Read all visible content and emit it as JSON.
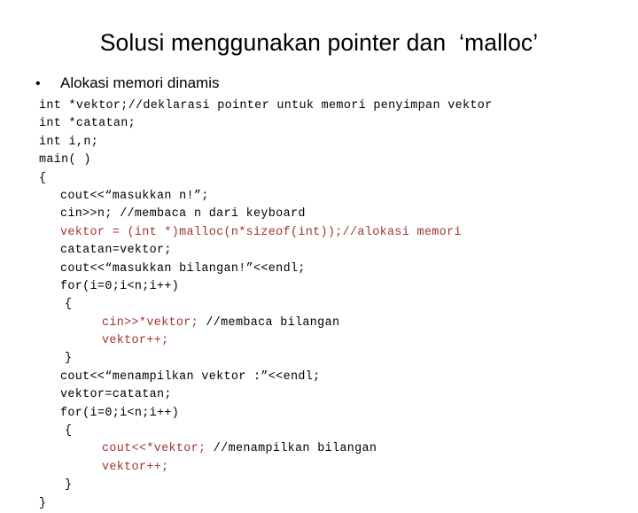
{
  "slide": {
    "title": "Solusi menggunakan pointer dan  ‘malloc’",
    "bullet_marker": "•",
    "bullet_text": "Alokasi memori dinamis",
    "colors": {
      "background": "#ffffff",
      "text": "#000000",
      "highlight": "#a33333"
    }
  },
  "code": {
    "lines": [
      {
        "indent": 0,
        "color": "#000000",
        "segments": [
          {
            "text": "int *vektor;//deklarasi pointer untuk memori penyimpan vektor",
            "color": "#000000"
          }
        ]
      },
      {
        "indent": 0,
        "color": "#000000",
        "segments": [
          {
            "text": "int *catatan;",
            "color": "#000000"
          }
        ]
      },
      {
        "indent": 0,
        "color": "#000000",
        "segments": [
          {
            "text": "int i,n;",
            "color": "#000000"
          }
        ]
      },
      {
        "indent": 0,
        "color": "#000000",
        "segments": [
          {
            "text": "main( )",
            "color": "#000000"
          }
        ]
      },
      {
        "indent": 0,
        "color": "#000000",
        "segments": [
          {
            "text": "{",
            "color": "#000000"
          }
        ]
      },
      {
        "indent": 1,
        "color": "#000000",
        "segments": [
          {
            "text": "cout<<“masukkan n!”;",
            "color": "#000000"
          }
        ]
      },
      {
        "indent": 1,
        "color": "#000000",
        "segments": [
          {
            "text": "cin>>n; //membaca n dari keyboard",
            "color": "#000000"
          }
        ]
      },
      {
        "indent": 1,
        "color": "#a33333",
        "segments": [
          {
            "text": "vektor = (int *)malloc(n*sizeof(int));//alokasi memori",
            "color": "#a33333"
          }
        ]
      },
      {
        "indent": 1,
        "color": "#000000",
        "segments": [
          {
            "text": "catatan=vektor;",
            "color": "#000000"
          }
        ]
      },
      {
        "indent": 1,
        "color": "#000000",
        "segments": [
          {
            "text": "cout<<“masukkan bilangan!”<<endl;",
            "color": "#000000"
          }
        ]
      },
      {
        "indent": 1,
        "color": "#000000",
        "segments": [
          {
            "text": "for(i=0;i<n;i++)",
            "color": "#000000"
          }
        ]
      },
      {
        "indent": 2,
        "color": "#000000",
        "segments": [
          {
            "text": "{",
            "color": "#000000"
          }
        ]
      },
      {
        "indent": 3,
        "color": "#000000",
        "segments": [
          {
            "text": "cin>>*vektor;",
            "color": "#a33333"
          },
          {
            "text": " //membaca bilangan",
            "color": "#000000"
          }
        ]
      },
      {
        "indent": 3,
        "color": "#a33333",
        "segments": [
          {
            "text": "vektor++;",
            "color": "#a33333"
          }
        ]
      },
      {
        "indent": 2,
        "color": "#000000",
        "segments": [
          {
            "text": "}",
            "color": "#000000"
          }
        ]
      },
      {
        "indent": 1,
        "color": "#000000",
        "segments": [
          {
            "text": "cout<<“menampilkan vektor :”<<endl;",
            "color": "#000000"
          }
        ]
      },
      {
        "indent": 1,
        "color": "#000000",
        "segments": [
          {
            "text": "vektor=catatan;",
            "color": "#000000"
          }
        ]
      },
      {
        "indent": 1,
        "color": "#000000",
        "segments": [
          {
            "text": "for(i=0;i<n;i++)",
            "color": "#000000"
          }
        ]
      },
      {
        "indent": 2,
        "color": "#000000",
        "segments": [
          {
            "text": "{",
            "color": "#000000"
          }
        ]
      },
      {
        "indent": 3,
        "color": "#000000",
        "segments": [
          {
            "text": "cout<<*vektor;",
            "color": "#a33333"
          },
          {
            "text": " //menampilkan bilangan",
            "color": "#000000"
          }
        ]
      },
      {
        "indent": 3,
        "color": "#a33333",
        "segments": [
          {
            "text": "vektor++;",
            "color": "#a33333"
          }
        ]
      },
      {
        "indent": 2,
        "color": "#000000",
        "segments": [
          {
            "text": "}",
            "color": "#000000"
          }
        ]
      },
      {
        "indent": 0,
        "color": "#000000",
        "segments": [
          {
            "text": "}",
            "color": "#000000"
          }
        ]
      }
    ]
  }
}
